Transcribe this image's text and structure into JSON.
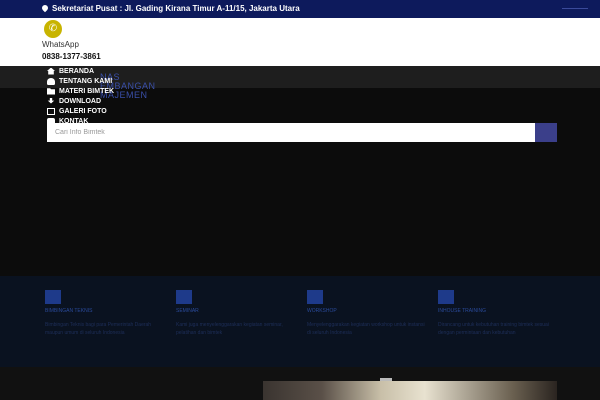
{
  "topbar": {
    "address": "Sekretariat Pusat : Jl. Gading Kirana Timur A-11/15, Jakarta Utara"
  },
  "header": {
    "whatsapp_label": "WhatsApp",
    "whatsapp_phone": "0838-1377-3861"
  },
  "logo": {
    "line1": "NAS",
    "line2": "EMBANGAN",
    "line3": "MAJEMEN"
  },
  "menu": {
    "items": [
      {
        "label": "BERANDA",
        "icon": "home-icon"
      },
      {
        "label": "TENTANG KAMI",
        "icon": "user-icon"
      },
      {
        "label": "MATERI BIMTEK",
        "icon": "folder-icon"
      },
      {
        "label": "DOWNLOAD",
        "icon": "download-icon"
      },
      {
        "label": "GALERI FOTO",
        "icon": "image-icon"
      },
      {
        "label": "KONTAK",
        "icon": "phone-icon"
      }
    ]
  },
  "search": {
    "placeholder": "Cari Info Bimtek"
  },
  "features": [
    {
      "title": "Bimbingan Teknis",
      "desc": "Bimbingan Teknis bagi para Pemerintah Daerah maupun umum di seluruh Indonesia"
    },
    {
      "title": "Seminar",
      "desc": "Kami juga menyelenggarakan kegiatan seminar, pelatihan dan bimtek"
    },
    {
      "title": "Workshop",
      "desc": "Menyelenggarakan kegiatan workshop untuk instansi di seluruh Indonesia"
    },
    {
      "title": "Inhouse Training",
      "desc": "Dirancang untuk kebutuhan training bimtek sesuai dengan permintaan dan kebutuhan"
    }
  ],
  "colors": {
    "topbar": "#0d1a5c",
    "accent": "#3b3f8a"
  }
}
